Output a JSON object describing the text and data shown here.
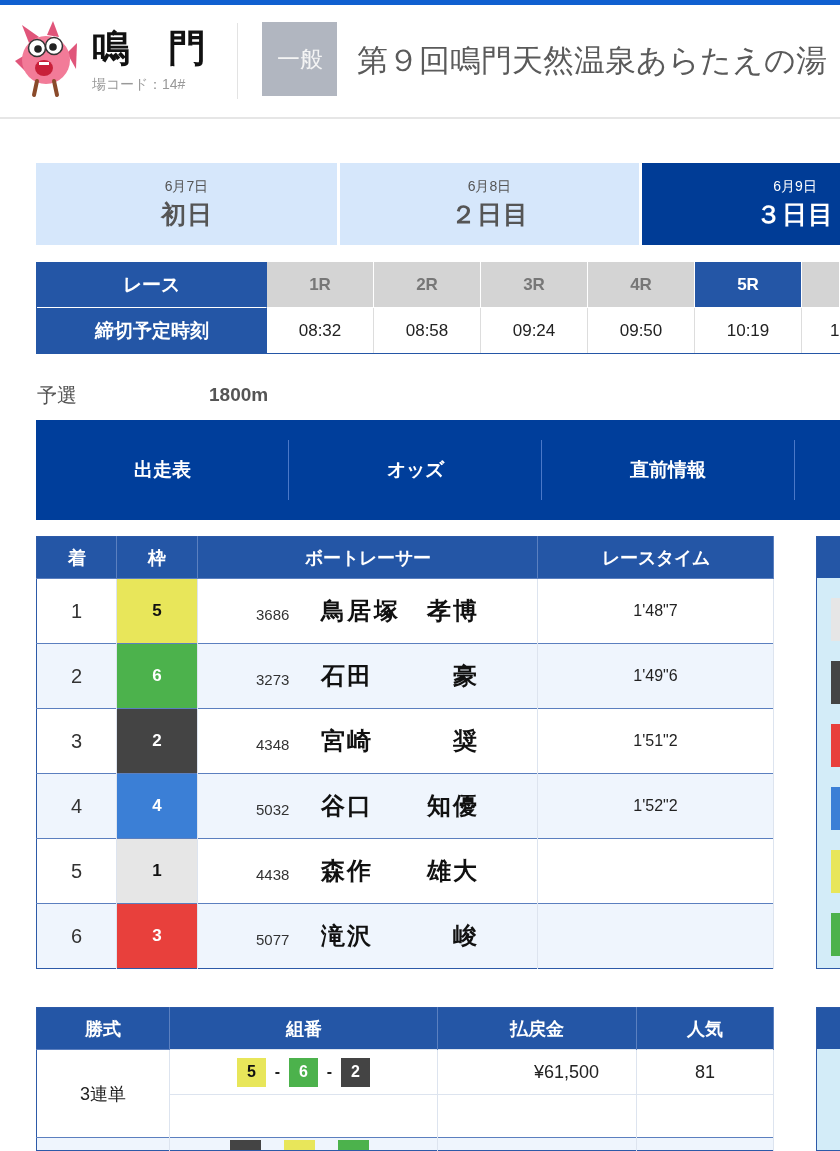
{
  "header": {
    "venue": "鳴　門",
    "venue_code": "場コード：14#",
    "grade": "一般",
    "title": "第９回鳴門天然温泉あらたえの湯"
  },
  "day_tabs": [
    {
      "date": "6月7日",
      "label": "初日",
      "selected": false
    },
    {
      "date": "6月8日",
      "label": "２日目",
      "selected": false
    },
    {
      "date": "6月9日",
      "label": "３日目",
      "selected": true
    }
  ],
  "race_table": {
    "row_labels": [
      "レース",
      "締切予定時刻"
    ],
    "races": [
      {
        "label": "1R",
        "time": "08:32",
        "selected": false
      },
      {
        "label": "2R",
        "time": "08:58",
        "selected": false
      },
      {
        "label": "3R",
        "time": "09:24",
        "selected": false
      },
      {
        "label": "4R",
        "time": "09:50",
        "selected": false
      },
      {
        "label": "5R",
        "time": "10:19",
        "selected": true
      },
      {
        "time": "1",
        "selected": false
      }
    ]
  },
  "race_info": {
    "type": "予選",
    "distance": "1800m"
  },
  "nav_items": [
    "出走表",
    "オッズ",
    "直前情報"
  ],
  "results": {
    "columns": [
      "着",
      "枠",
      "ボートレーサー",
      "レースタイム"
    ],
    "rows": [
      {
        "place": "1",
        "frame": {
          "number": "5",
          "color": "#e8e65a"
        },
        "racer_id": "3686",
        "name": "鳥居塚　孝博",
        "time": "1'48\"7"
      },
      {
        "place": "2",
        "frame": {
          "number": "6",
          "color": "#4cb24c"
        },
        "racer_id": "3273",
        "name": "石田　　　豪",
        "time": "1'49\"6"
      },
      {
        "place": "3",
        "frame": {
          "number": "2",
          "color": "#444444"
        },
        "racer_id": "4348",
        "name": "宮崎　　　奨",
        "time": "1'51\"2"
      },
      {
        "place": "4",
        "frame": {
          "number": "4",
          "color": "#3b7fd6"
        },
        "racer_id": "5032",
        "name": "谷口　　知優",
        "time": "1'52\"2"
      },
      {
        "place": "5",
        "frame": {
          "number": "1",
          "color": "#e6e6e6"
        },
        "racer_id": "4438",
        "name": "森作　　雄大"
      },
      {
        "place": "6",
        "frame": {
          "number": "3",
          "color": "#e8403c"
        },
        "racer_id": "5077",
        "name": "滝沢　　　峻"
      }
    ]
  },
  "side_panel": {
    "tiles": [
      {
        "color": "#e6e6e6"
      },
      {
        "color": "#444444"
      },
      {
        "color": "#e8403c"
      },
      {
        "color": "#3b7fd6"
      },
      {
        "color": "#e8e65a"
      },
      {
        "color": "#4cb24c"
      }
    ]
  },
  "payouts": {
    "columns": [
      "勝式",
      "組番",
      "払戻金",
      "人気"
    ],
    "rows": [
      {
        "bet_type": "3連単",
        "combination": [
          {
            "number": "5",
            "color": "#e8e65a"
          },
          {
            "number": "6",
            "color": "#4cb24c"
          },
          {
            "number": "2",
            "color": "#444444"
          }
        ],
        "separator": "-",
        "payout": "¥61,500",
        "popularity": "81"
      },
      {
        "combination": [
          {
            "color": "#444444"
          },
          {
            "color": "#e8e65a"
          },
          {
            "color": "#4cb24c"
          }
        ]
      }
    ]
  }
}
